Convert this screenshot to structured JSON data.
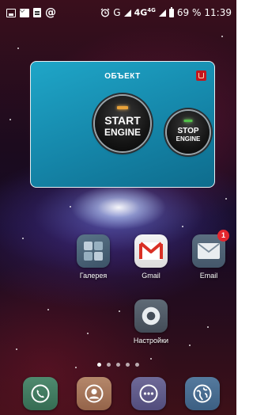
{
  "status_bar": {
    "notification_icons": [
      "image-icon",
      "mail-icon",
      "document-icon",
      "at-icon"
    ],
    "alarm_icon": "alarm-icon",
    "carrier": "G",
    "network": "4G",
    "network_sup": "4G",
    "battery_percent": "69 %",
    "time": "11:39"
  },
  "widget": {
    "title": "ОБЪЕКТ",
    "flag_icon": "red-flag-icon",
    "start_button": {
      "line1": "START",
      "line2": "ENGINE",
      "led_color": "#e8a23a"
    },
    "stop_button": {
      "line1": "STOP",
      "line2": "ENGINE",
      "led_color": "#52c24a"
    }
  },
  "apps": [
    {
      "label": "Галерея",
      "icon": "gallery-icon"
    },
    {
      "label": "Gmail",
      "icon": "gmail-icon"
    },
    {
      "label": "Email",
      "icon": "email-icon",
      "badge": "1"
    },
    {
      "label": "Настройки",
      "icon": "settings-icon"
    }
  ],
  "page_indicator": {
    "count": 5,
    "active_index": 0
  },
  "dock": [
    {
      "icon": "phone-icon"
    },
    {
      "icon": "contacts-icon"
    },
    {
      "icon": "app-drawer-icon"
    },
    {
      "icon": "browser-icon"
    }
  ],
  "colors": {
    "widget_bg": "#1586a9",
    "badge_red": "#e3262e",
    "gmail_red": "#d93025"
  }
}
